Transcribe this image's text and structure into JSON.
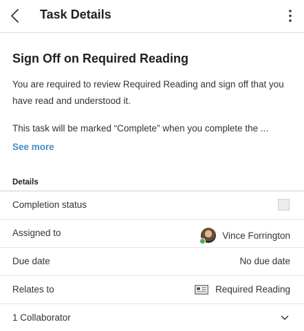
{
  "header": {
    "title": "Task Details",
    "back_icon": "chevron-left-icon",
    "menu_icon": "more-vertical-icon"
  },
  "task": {
    "title": "Sign Off on Required Reading",
    "description_1": "You are required to review Required Reading and sign off that you have read and understood it.",
    "description_2": "This task will be marked “Complete” when you complete the ...",
    "see_more": "See more"
  },
  "details": {
    "section_label": "Details",
    "rows": [
      {
        "label": "Completion status",
        "checked": false
      },
      {
        "label": "Assigned to",
        "value": "Vince Forrington",
        "presence": "online"
      },
      {
        "label": "Due date",
        "value": "No due date"
      },
      {
        "label": "Relates to",
        "value": "Required Reading",
        "icon": "document-icon"
      },
      {
        "label": "1 Collaborator",
        "icon": "chevron-down-icon"
      }
    ]
  },
  "colors": {
    "link": "#3c8fd0",
    "presence_online": "#4caf50",
    "divider": "#dcdcdc"
  }
}
